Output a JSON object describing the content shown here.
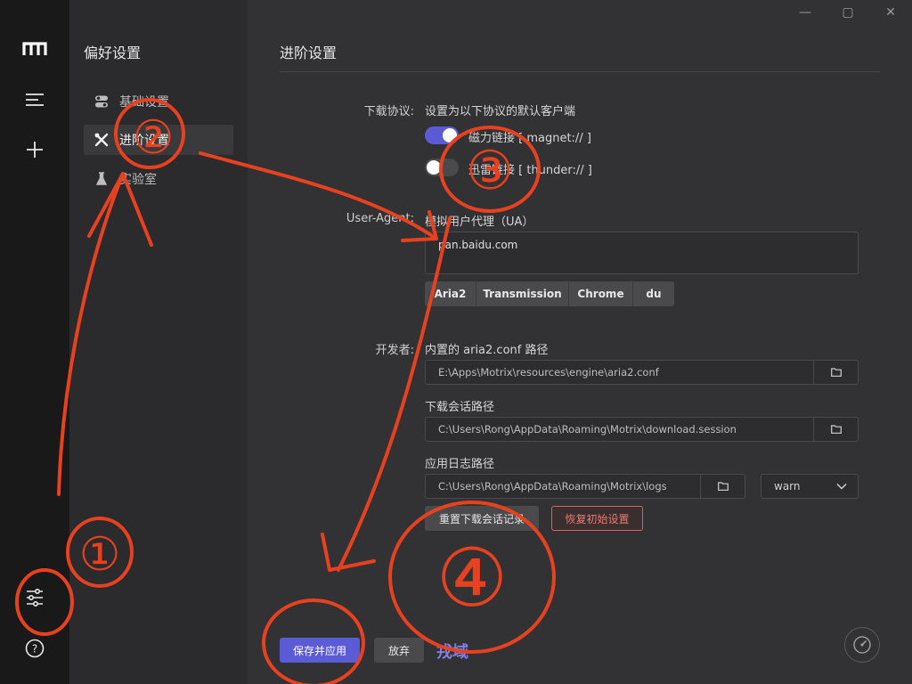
{
  "window": {
    "minimize": "—",
    "maximize": "▢",
    "close": "✕"
  },
  "rail": {
    "logo": "m-logo-icon",
    "menu": "menu-icon",
    "add": "plus-icon",
    "settings": "sliders-icon",
    "help": "help-icon"
  },
  "sidebar": {
    "title": "偏好设置",
    "items": [
      {
        "label": "基础设置",
        "icon": "toggles-icon",
        "active": false
      },
      {
        "label": "进阶设置",
        "icon": "tools-icon",
        "active": true
      },
      {
        "label": "实验室",
        "icon": "flask-icon",
        "active": false
      }
    ]
  },
  "main": {
    "title": "进阶设置",
    "protocol": {
      "label": "下载协议:",
      "desc": "设置为以下协议的默认客户端",
      "magnet": {
        "label": "磁力链接 [ magnet:// ]",
        "on": true
      },
      "thunder": {
        "label": "迅雷链接 [ thunder:// ]",
        "on": false
      }
    },
    "ua": {
      "label": "User-Agent:",
      "desc": "模拟用户代理（UA）",
      "value": "pan.baidu.com",
      "presets": [
        "Aria2",
        "Transmission",
        "Chrome",
        "du"
      ]
    },
    "dev": {
      "label": "开发者:",
      "aria2_label": "内置的 aria2.conf 路径",
      "aria2_path": "E:\\Apps\\Motrix\\resources\\engine\\aria2.conf",
      "session_label": "下载会话路径",
      "session_path": "C:\\Users\\Rong\\AppData\\Roaming\\Motrix\\download.session",
      "log_label": "应用日志路径",
      "log_path": "C:\\Users\\Rong\\AppData\\Roaming\\Motrix\\logs",
      "log_level": "warn",
      "reset_session": "重置下载会话记录",
      "restore_defaults": "恢复初始设置"
    },
    "footer": {
      "save": "保存并应用",
      "discard": "放弃",
      "watermark": "戎域"
    }
  },
  "annotations": [
    "①",
    "②",
    "③",
    "④"
  ]
}
